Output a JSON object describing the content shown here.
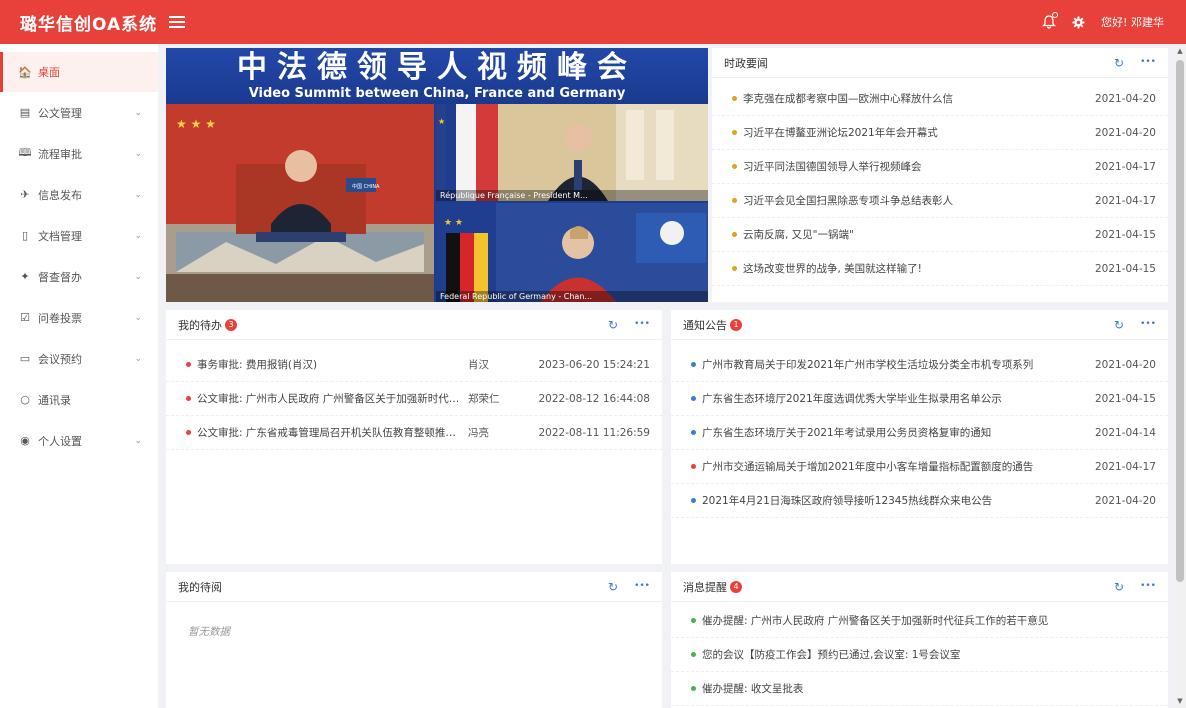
{
  "header": {
    "brand": "璐华信创OA系统",
    "greeting": "您好! 邓建华"
  },
  "sidebar": {
    "items": [
      {
        "label": "桌面",
        "icon": "home-icon",
        "glyph": "🏠",
        "active": true,
        "chevron": false
      },
      {
        "label": "公文管理",
        "icon": "document-icon",
        "glyph": "▤",
        "chevron": true
      },
      {
        "label": "流程审批",
        "icon": "book-icon",
        "glyph": "🕮",
        "chevron": true
      },
      {
        "label": "信息发布",
        "icon": "send-icon",
        "glyph": "✈",
        "chevron": true
      },
      {
        "label": "文档管理",
        "icon": "file-icon",
        "glyph": "▯",
        "chevron": true
      },
      {
        "label": "督查督办",
        "icon": "inspect-icon",
        "glyph": "✦",
        "chevron": true
      },
      {
        "label": "问卷投票",
        "icon": "checkbox-icon",
        "glyph": "☑",
        "chevron": true
      },
      {
        "label": "会议预约",
        "icon": "folder-icon",
        "glyph": "▭",
        "chevron": true
      },
      {
        "label": "通讯录",
        "icon": "circle-icon",
        "glyph": "○",
        "chevron": false
      },
      {
        "label": "个人设置",
        "icon": "user-settings-icon",
        "glyph": "◉",
        "chevron": true
      }
    ],
    "chevron_glyph": "⌄"
  },
  "banner": {
    "title_cn": "中法德领导人视频峰会",
    "title_en": "Video Summit between China, France and Germany",
    "caption_fr": "République Française - President M...",
    "caption_de": "Federal Republic of Germany - Chan...",
    "flag_label": "中国 CHINA"
  },
  "tools": {
    "refresh": "↻",
    "more": "•••"
  },
  "news": {
    "title": "时政要闻",
    "bullet_color": "#e0a020",
    "items": [
      {
        "text": "李克强在成都考察中国—欧洲中心释放什么信",
        "date": "2021-04-20"
      },
      {
        "text": "习近平在博鳌亚洲论坛2021年年会开幕式",
        "date": "2021-04-20"
      },
      {
        "text": "习近平同法国德国领导人举行视频峰会",
        "date": "2021-04-17"
      },
      {
        "text": "习近平会见全国扫黑除恶专项斗争总结表彰人",
        "date": "2021-04-17"
      },
      {
        "text": "云南反腐, 又见\"一锅端\"",
        "date": "2021-04-15"
      },
      {
        "text": "这场改变世界的战争, 美国就这样输了!",
        "date": "2021-04-15"
      }
    ]
  },
  "todo": {
    "title": "我的待办",
    "count": "3",
    "bullet_color": "#e8413a",
    "items": [
      {
        "text": "事务审批: 费用报销(肖汉)",
        "who": "肖汉",
        "time": "2023-06-20 15:24:21"
      },
      {
        "text": "公文审批: 广州市人民政府 广州警备区关于加强新时代征...",
        "who": "郑荣仁",
        "time": "2022-08-12 16:44:08"
      },
      {
        "text": "公文审批: 广东省戒毒管理局召开机关队伍教育整顿推进会",
        "who": "冯亮",
        "time": "2022-08-11 11:26:59"
      }
    ]
  },
  "notice": {
    "title": "通知公告",
    "count": "1",
    "items": [
      {
        "text": "广州市教育局关于印发2021年广州市学校生活垃圾分类全市机专项系列",
        "date": "2021-04-20",
        "color": "#3a7bd5"
      },
      {
        "text": "广东省生态环境厅2021年度选调优秀大学毕业生拟录用名单公示",
        "date": "2021-04-15",
        "color": "#3a7bd5"
      },
      {
        "text": "广东省生态环境厅关于2021年考试录用公务员资格复审的通知",
        "date": "2021-04-14",
        "color": "#3a7bd5"
      },
      {
        "text": "广州市交通运输局关于增加2021年度中小客车增量指标配置额度的通告",
        "date": "2021-04-17",
        "color": "#e8413a"
      },
      {
        "text": "2021年4月21日海珠区政府领导接听12345热线群众来电公告",
        "date": "2021-04-20",
        "color": "#3a7bd5"
      }
    ]
  },
  "toread": {
    "title": "我的待阅",
    "empty": "暂无数据"
  },
  "messages": {
    "title": "消息提醒",
    "count": "4",
    "bullet_color": "#4caf50",
    "items": [
      {
        "text": "催办提醒: 广州市人民政府 广州警备区关于加强新时代征兵工作的若干意见"
      },
      {
        "text": "您的会议【防疫工作会】预约已通过,会议室: 1号会议室"
      },
      {
        "text": "催办提醒: 收文呈批表"
      }
    ]
  },
  "scrollbar": {
    "up": "▲",
    "down": "▼"
  }
}
